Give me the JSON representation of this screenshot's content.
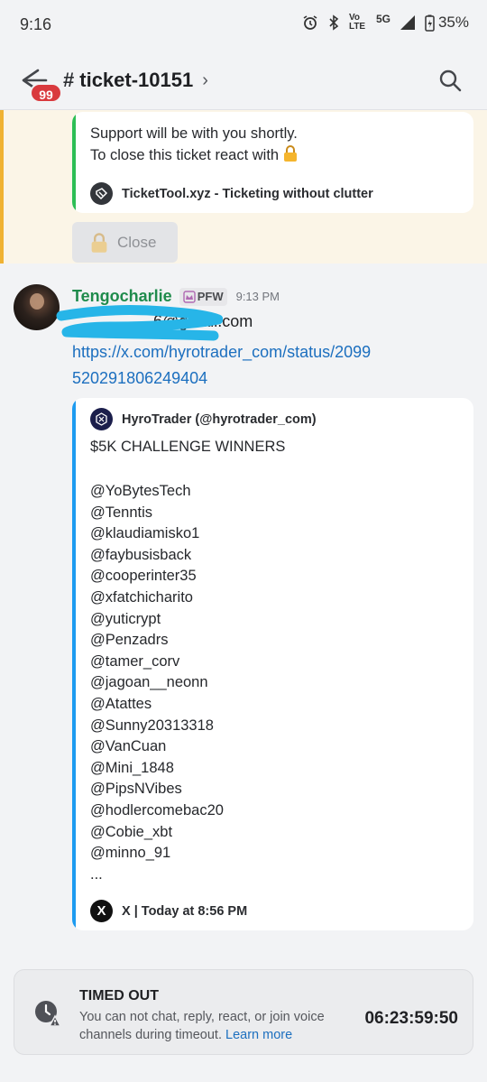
{
  "status_bar": {
    "time": "9:16",
    "network_label": "Vo LTE",
    "network_type": "5G",
    "battery": "35%"
  },
  "header": {
    "badge_count": "99",
    "channel_prefix": "#",
    "channel_name": "ticket-10151",
    "chevron": "›"
  },
  "bot_embed": {
    "line1": "Support will be with you shortly.",
    "line2": "To close this ticket react with",
    "footer": "TicketTool.xyz - Ticketing without clutter",
    "accent": "#2dbe55"
  },
  "close_button": {
    "label": "Close"
  },
  "message": {
    "author": "Tengocharlie",
    "role_tag": "PFW",
    "time": "9:13 PM",
    "email_visible": "6@gmail.com",
    "link": "https://x.com/hyrotrader_com/status/2099520291806249404"
  },
  "tweet_embed": {
    "author": "HyroTrader (@hyrotrader_com)",
    "title": "$5K CHALLENGE WINNERS",
    "winners": [
      "@YoBytesTech",
      "@Tenntis",
      "@klaudiamisko1",
      "@faybusisback",
      "@cooperinter35",
      "@xfatchicharito",
      "@yuticrypt",
      "@Penzadrs",
      "@tamer_corv",
      "@jagoan__neonn",
      "@Atattes",
      "@Sunny20313318",
      "@VanCuan",
      "@Mini_1848",
      "@PipsNVibes",
      "@hodlercomebac20",
      "@Cobie_xbt",
      "@minno_91",
      "..."
    ],
    "footer": "X | Today at 8:56 PM",
    "accent": "#1d9bf0"
  },
  "timeout": {
    "title": "TIMED OUT",
    "text": "You can not chat, reply, react, or join voice channels during timeout.",
    "learn_more": "Learn more",
    "timer": "06:23:59:50"
  },
  "icons": [
    "back-arrow-icon",
    "search-icon",
    "lock-icon",
    "tickettool-logo-icon",
    "hyrotrader-logo-icon",
    "x-logo-icon",
    "clock-warning-icon",
    "alarm-icon",
    "bluetooth-icon",
    "signal-icon",
    "battery-icon"
  ]
}
